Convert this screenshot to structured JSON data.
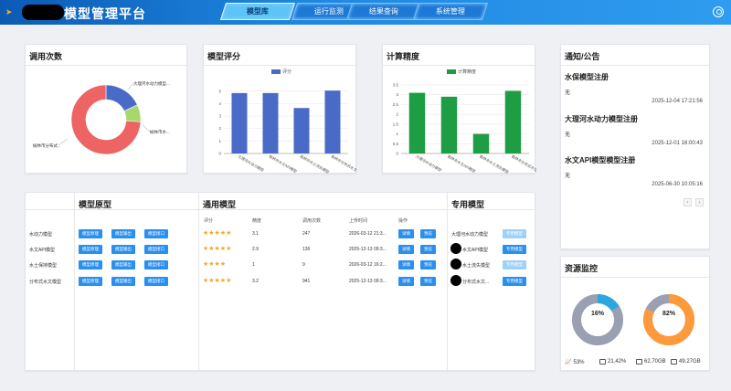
{
  "header": {
    "title": "模型管理平台",
    "nav": [
      {
        "label": "模型库",
        "active": true
      },
      {
        "label": "运行监测",
        "active": false
      },
      {
        "label": "结果查询",
        "active": false
      },
      {
        "label": "系统管理",
        "active": false
      }
    ]
  },
  "usage": {
    "title": "调用次数",
    "labels": [
      "大理河水动力模型...",
      "榆林市水...",
      "榆林市分布式..."
    ],
    "chart_data": {
      "type": "pie",
      "categories": [
        "大理河水动力模型",
        "榆林市水",
        "榆林市分布式"
      ],
      "values": [
        18,
        8,
        74
      ]
    }
  },
  "score": {
    "title": "模型评分",
    "legend": "评分",
    "chart_data": {
      "type": "bar",
      "series": [
        {
          "name": "评分",
          "values": [
            4.85,
            4.85,
            3.65,
            5.05
          ]
        }
      ],
      "categories": [
        "大理河水动力模型",
        "榆林市水文API模型",
        "榆林市水土流失模型",
        "榆林市分布式水文"
      ],
      "yticks": [
        "0",
        "1",
        "2",
        "3",
        "4",
        "5"
      ],
      "ylim": [
        0,
        5.5
      ],
      "color": "#4a6ac7"
    }
  },
  "accuracy": {
    "title": "计算精度",
    "legend": "计算精度",
    "chart_data": {
      "type": "bar",
      "series": [
        {
          "name": "计算精度",
          "values": [
            3.1,
            2.9,
            1.0,
            3.2
          ]
        }
      ],
      "categories": [
        "大理河水动力模型",
        "榆林市水文API模型",
        "榆林市水土流失模型",
        "榆林市分布式水文"
      ],
      "yticks": [
        "0",
        "0.5",
        "1",
        "1.5",
        "2",
        "2.5",
        "3",
        "3.5"
      ],
      "ylim": [
        0,
        3.5
      ],
      "color": "#1f9d45"
    }
  },
  "notice": {
    "title": "通知/公告",
    "items": [
      {
        "title": "水保模型注册",
        "sub": "无",
        "date": "2025-12-04 17:21:56"
      },
      {
        "title": "大理河水动力模型注册",
        "sub": "无",
        "date": "2025-12-01 16:00:43"
      },
      {
        "title": "水文API模型模型注册",
        "sub": "无",
        "date": "2025-06-30 10:05:16"
      }
    ],
    "prev": "‹",
    "next": "›"
  },
  "models": {
    "prototype_title": "模型原型",
    "general_title": "通用模型",
    "dedicated_title": "专用模型",
    "headers": [
      "评分",
      "精度",
      "调用次数",
      "上传时间",
      "操作"
    ],
    "rows": [
      {
        "name": "水动力模型",
        "proto": [
          "模型原理",
          "模型输出",
          "模型接口"
        ],
        "stars": "★★★★★",
        "score": "3.1",
        "calls": "247",
        "time": "2026-03-12 21:3...",
        "ops": [
          "详情",
          "预览"
        ],
        "dedicated": "大理河水动力模型",
        "dedicated_btn": "专用模型",
        "dedicated_btn_light": true
      },
      {
        "name": "水文API模型",
        "proto": [
          "模型原理",
          "模型输出",
          "模型接口"
        ],
        "stars": "★★★★★",
        "score": "2.9",
        "calls": "136",
        "time": "2025-12-13 09:3...",
        "ops": [
          "详情",
          "预览"
        ],
        "dedicated": "水文API模型",
        "dedicated_btn": "专用模型",
        "dedicated_btn_light": false
      },
      {
        "name": "水土保持模型",
        "proto": [
          "模型原理",
          "模型输出",
          "模型接口"
        ],
        "stars": "★★★★",
        "score": "1",
        "calls": "9",
        "time": "2026-03-12 16:2...",
        "ops": [
          "详情",
          "预览"
        ],
        "dedicated": "水土流失模型",
        "dedicated_btn": "专用模型",
        "dedicated_btn_light": true
      },
      {
        "name": "分布式水文模型",
        "proto": [
          "模型原理",
          "模型输出",
          "模型接口"
        ],
        "stars": "★★★★★",
        "score": "3.2",
        "calls": "941",
        "time": "2025-12-13 09:3...",
        "ops": [
          "详情",
          "预览"
        ],
        "dedicated": "分布式水文...",
        "dedicated_btn": "专用模型",
        "dedicated_btn_light": false
      }
    ]
  },
  "resource": {
    "title": "资源监控",
    "gauges": [
      {
        "label": "16%",
        "value": 16,
        "color": "#2aa7e0"
      },
      {
        "label": "82%",
        "value": 82,
        "color": "#ff9a3c"
      }
    ],
    "stats": [
      "53%",
      "21.42%",
      "62.70GB",
      "49.27GB"
    ]
  }
}
